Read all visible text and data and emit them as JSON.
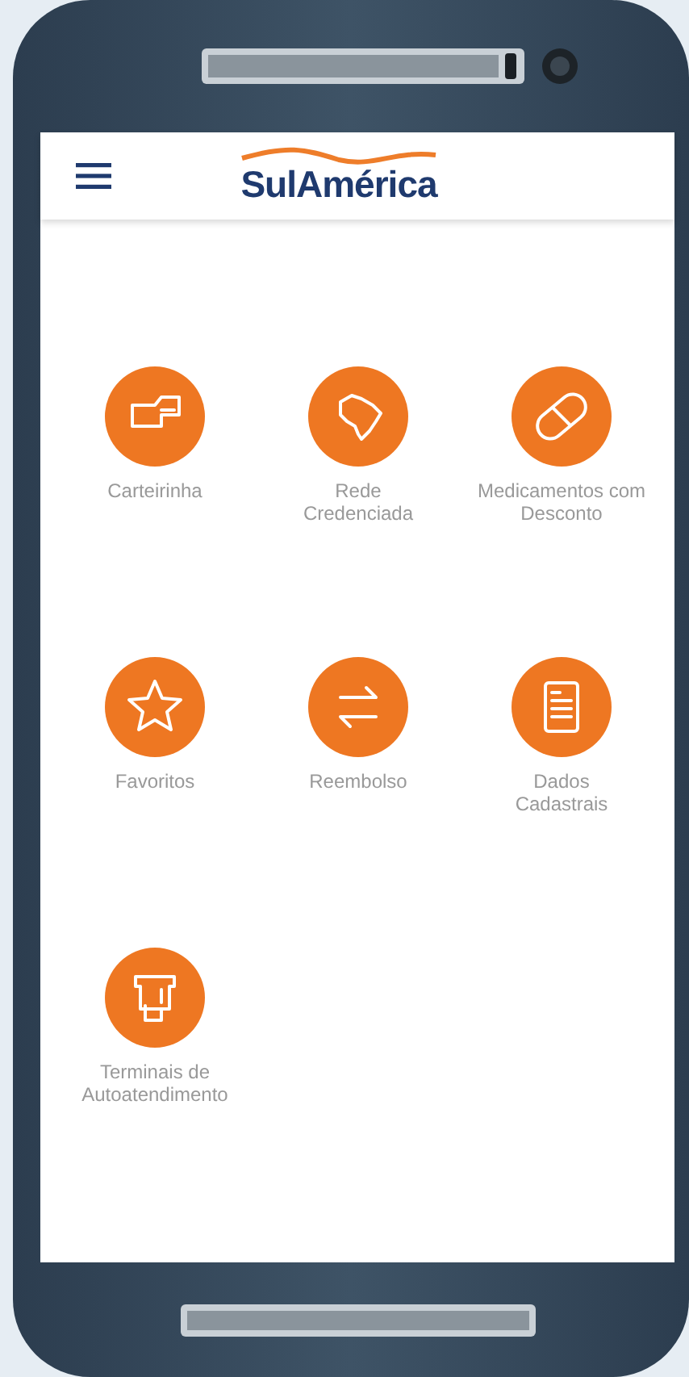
{
  "header": {
    "brand": "SulAmérica"
  },
  "menu_items": [
    {
      "kind": "card",
      "label_lines": [
        "Carteirinha"
      ]
    },
    {
      "kind": "map",
      "label_lines": [
        "Rede",
        "Credenciada"
      ]
    },
    {
      "kind": "pill",
      "label_lines": [
        "Medicamentos com",
        "Desconto"
      ]
    },
    {
      "kind": "star",
      "label_lines": [
        "Favoritos"
      ]
    },
    {
      "kind": "exchange",
      "label_lines": [
        "Reembolso"
      ]
    },
    {
      "kind": "document",
      "label_lines": [
        "Dados",
        "Cadastrais"
      ]
    },
    {
      "kind": "terminal",
      "label_lines": [
        "Terminais de",
        "Autoatendimento"
      ]
    }
  ]
}
